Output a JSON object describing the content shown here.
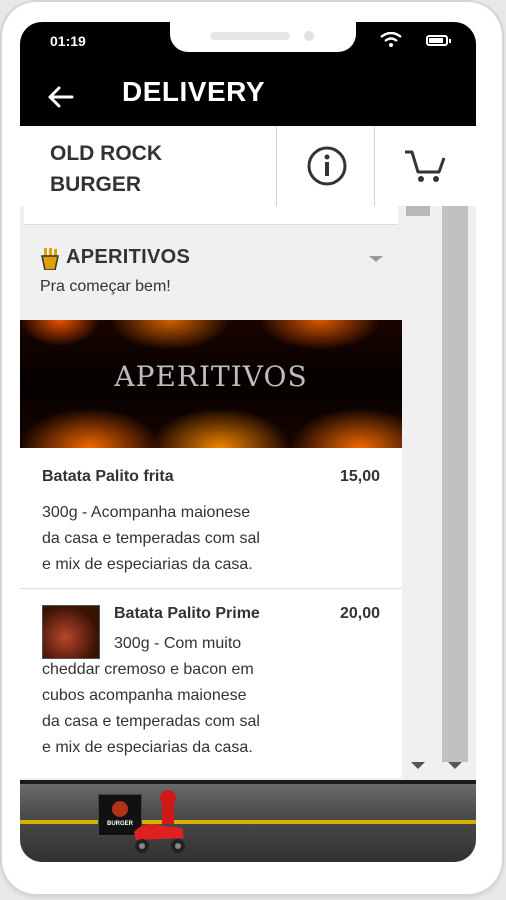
{
  "status_bar": {
    "time": "01:19"
  },
  "header": {
    "title": "DELIVERY"
  },
  "store": {
    "name_line1": "OLD ROCK",
    "name_line2": "BURGER"
  },
  "category": {
    "title": "APERITIVOS",
    "subtitle": "Pra começar bem!",
    "banner_text": "APERITIVOS"
  },
  "products": [
    {
      "name": "Batata Palito frita",
      "price": "15,00",
      "description_lines": [
        "300g - Acompanha maionese",
        "da casa e temperadas com sal",
        "e mix de especiarias da casa."
      ]
    },
    {
      "name": "Batata Palito Prime",
      "price": "20,00",
      "description_lines": [
        "300g - Com muito",
        "cheddar cremoso e bacon em",
        "cubos acompanha maionese",
        "da casa e temperadas com sal",
        "e mix de especiarias da casa."
      ]
    }
  ],
  "footer": {
    "logo_text": "BURGER"
  },
  "colors": {
    "header_bg": "#000000",
    "accent": "#d4b000"
  }
}
